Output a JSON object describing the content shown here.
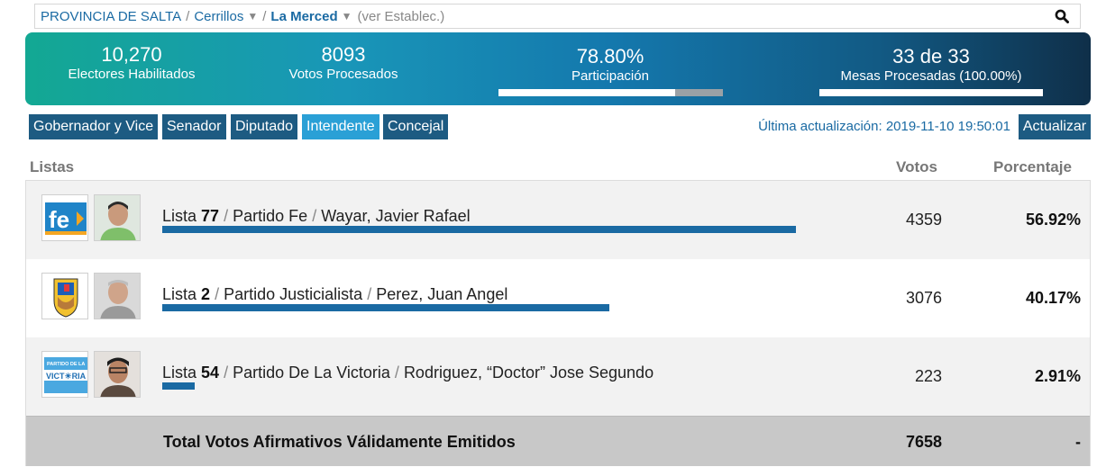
{
  "breadcrumb": {
    "province": "PROVINCIA DE SALTA",
    "department": "Cerrillos",
    "caret": "▼",
    "municipality": "La Merced",
    "view_link": "(ver Establec.)"
  },
  "stats": {
    "electores_value": "10,270",
    "electores_label": "Electores Habilitados",
    "votos_value": "8093",
    "votos_label": "Votos Procesados",
    "participacion_value": "78.80%",
    "participacion_label": "Participación",
    "participacion_fraction": 0.788,
    "mesas_value": "33 de 33",
    "mesas_label": "Mesas Procesadas (100.00%)",
    "mesas_fraction": 1.0
  },
  "tabs": [
    {
      "label": "Gobernador y Vice",
      "active": false
    },
    {
      "label": "Senador",
      "active": false
    },
    {
      "label": "Diputado",
      "active": false
    },
    {
      "label": "Intendente",
      "active": true
    },
    {
      "label": "Concejal",
      "active": false
    }
  ],
  "update": {
    "text": "Última actualización: 2019-11-10 19:50:01",
    "button": "Actualizar"
  },
  "table": {
    "headers": {
      "listas": "Listas",
      "votos": "Votos",
      "porcentaje": "Porcentaje"
    },
    "rows": [
      {
        "lista_word": "Lista",
        "lista_num": "77",
        "sep": "/",
        "party": "Partido Fe",
        "candidate": "Wayar, Javier Rafael",
        "votes": "4359",
        "pct": "56.92%",
        "share": 0.5692,
        "logo_text": "fe"
      },
      {
        "lista_word": "Lista",
        "lista_num": "2",
        "sep": "/",
        "party": "Partido Justicialista",
        "candidate": "Perez, Juan Angel",
        "votes": "3076",
        "pct": "40.17%",
        "share": 0.4017
      },
      {
        "lista_word": "Lista",
        "lista_num": "54",
        "sep": "/",
        "party": "Partido De La Victoria",
        "candidate": "Rodriguez, “Doctor” Jose Segundo",
        "votes": "223",
        "pct": "2.91%",
        "share": 0.0291,
        "logo_text_top": "PARTIDO DE LA",
        "logo_text_main": "VICT☀RIA"
      }
    ],
    "total": {
      "label": "Total Votos Afirmativos Válidamente Emitidos",
      "votes": "7658",
      "pct": "-"
    }
  },
  "colors": {
    "accent": "#1a6aa3",
    "tab": "#1d5b82",
    "tab_active": "#2aa0d6",
    "bar": "#1a6aa3"
  }
}
